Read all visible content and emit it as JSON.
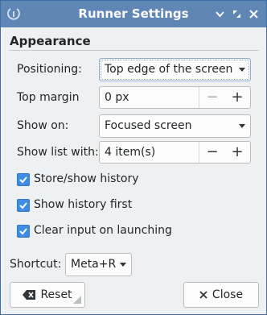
{
  "window": {
    "title": "Runner Settings",
    "controls": {
      "minimize": "▾",
      "maximize": "⤢",
      "close": "✕"
    }
  },
  "appearance": {
    "heading": "Appearance",
    "positioning": {
      "label": "Positioning:",
      "value": "Top edge of the screen"
    },
    "top_margin": {
      "label": "Top margin",
      "value": "0 px",
      "minus": "−",
      "plus": "+"
    },
    "show_on": {
      "label": "Show on:",
      "value": "Focused screen"
    },
    "show_list_with": {
      "label": "Show list with:",
      "value": "4 item(s)",
      "minus": "−",
      "plus": "+"
    },
    "options": [
      {
        "label": "Store/show history",
        "checked": true
      },
      {
        "label": "Show history first",
        "checked": true
      },
      {
        "label": "Clear input on launching",
        "checked": true
      }
    ]
  },
  "shortcut": {
    "label": "Shortcut:",
    "value": "Meta+R"
  },
  "buttons": {
    "reset": "Reset",
    "close": "Close"
  },
  "colors": {
    "titlebar": "#5f86b5",
    "checkbox_accent": "#3d8ee0",
    "background": "#eff0f1"
  }
}
